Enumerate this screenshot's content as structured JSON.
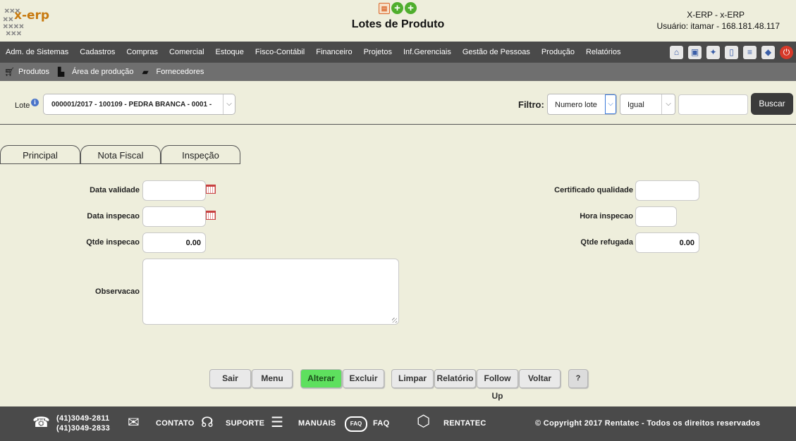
{
  "header": {
    "logo_text": "x-erp",
    "title": "Lotes de Produto",
    "system_name": "X-ERP - x-ERP",
    "user_line": "Usuário: itamar - 168.181.48.117"
  },
  "menu": {
    "items": [
      "Adm. de Sistemas",
      "Cadastros",
      "Compras",
      "Comercial",
      "Estoque",
      "Fisco-Contábil",
      "Financeiro",
      "Projetos",
      "Inf.Gerenciais",
      "Gestão de Pessoas",
      "Produção",
      "Relatórios"
    ],
    "icons": [
      "home-icon",
      "save-icon",
      "certificate-icon",
      "document-icon",
      "notes-icon",
      "chat-icon",
      "power-icon"
    ]
  },
  "submenu": {
    "items": [
      {
        "label": "Produtos",
        "icon": "cart-icon"
      },
      {
        "label": "Área de produção",
        "icon": "factory-icon"
      },
      {
        "label": "Fornecedores",
        "icon": "truck-icon"
      }
    ]
  },
  "lote": {
    "label": "Lote",
    "value": "000001/2017 - 100109 - PEDRA BRANCA - 0001 -"
  },
  "filtro": {
    "label": "Filtro:",
    "field": "Numero lote",
    "operator": "Igual",
    "value": "",
    "search_button": "Buscar"
  },
  "tabs": [
    "Principal",
    "Nota Fiscal",
    "Inspeção"
  ],
  "active_tab": "Inspeção",
  "form": {
    "data_validade": {
      "label": "Data validade",
      "value": ""
    },
    "data_inspecao": {
      "label": "Data inspecao",
      "value": ""
    },
    "qtde_inspecao": {
      "label": "Qtde inspecao",
      "value": "0.00"
    },
    "observacao": {
      "label": "Observacao",
      "value": ""
    },
    "certificado_qualidade": {
      "label": "Certificado qualidade",
      "value": ""
    },
    "hora_inspecao": {
      "label": "Hora inspecao",
      "value": ""
    },
    "qtde_refugada": {
      "label": "Qtde refugada",
      "value": "0.00"
    }
  },
  "buttons": {
    "sair": "Sair",
    "menu": "Menu",
    "alterar": "Alterar",
    "excluir": "Excluir",
    "limpar": "Limpar",
    "relatorio": "Relatório",
    "follow_up": "Follow Up",
    "voltar": "Voltar",
    "help": "?"
  },
  "footer": {
    "phone1": "(41)3049-2811",
    "phone2": "(41)3049-2833",
    "contato": "CONTATO",
    "suporte": "SUPORTE",
    "manuais": "MANUAIS",
    "faq": "FAQ",
    "faq_icon_text": "FAQ",
    "rentatec": "RENTATEC",
    "copyright": "© Copyright 2017 Rentatec - Todos os direitos reservados"
  },
  "colors": {
    "background": "#eeeedc",
    "menubar": "#4a4a4a",
    "submenubar": "#6f6f6f",
    "accent_green": "#5ee05e"
  }
}
